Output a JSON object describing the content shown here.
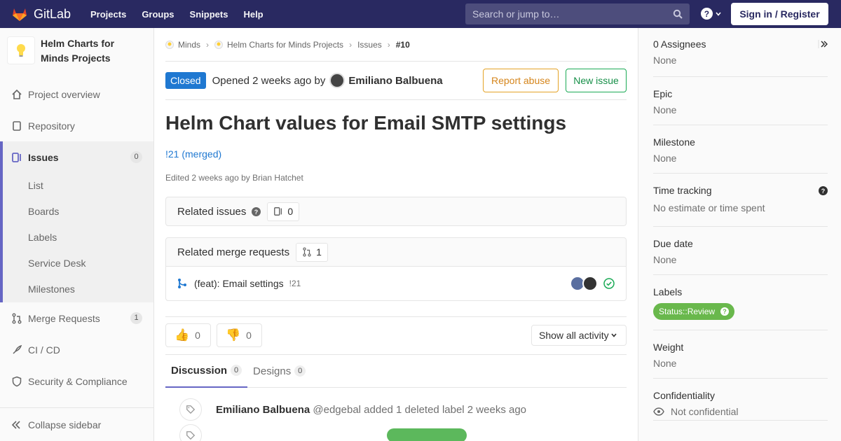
{
  "navbar": {
    "brand": "GitLab",
    "links": [
      "Projects",
      "Groups",
      "Snippets",
      "Help"
    ],
    "search_placeholder": "Search or jump to…",
    "signin_label": "Sign in / Register"
  },
  "sidebar": {
    "project_title": "Helm Charts for Minds Projects",
    "items": [
      {
        "label": "Project overview",
        "icon": "home-icon"
      },
      {
        "label": "Repository",
        "icon": "doc-icon"
      },
      {
        "label": "Issues",
        "icon": "issues-icon",
        "count": "0"
      },
      {
        "label": "Merge Requests",
        "icon": "merge-icon",
        "count": "1"
      },
      {
        "label": "CI / CD",
        "icon": "rocket-icon"
      },
      {
        "label": "Security & Compliance",
        "icon": "shield-icon"
      }
    ],
    "sub_items": [
      "List",
      "Boards",
      "Labels",
      "Service Desk",
      "Milestones"
    ],
    "collapse_label": "Collapse sidebar"
  },
  "breadcrumb": [
    "Minds",
    "Helm Charts for Minds Projects",
    "Issues",
    "#10"
  ],
  "issue": {
    "status": "Closed",
    "opened_text": "Opened 2 weeks ago by",
    "author": "Emiliano Balbuena",
    "report_label": "Report abuse",
    "new_issue_label": "New issue",
    "title": "Helm Chart values for Email SMTP settings",
    "mr_link": "!21 (merged)",
    "edited": "Edited 2 weeks ago by Brian Hatchet"
  },
  "related_issues": {
    "title": "Related issues",
    "count": "0"
  },
  "related_mrs": {
    "title": "Related merge requests",
    "count": "1",
    "items": [
      {
        "title": "(feat): Email settings",
        "ref": "!21"
      }
    ]
  },
  "awards": {
    "thumbs_up": "0",
    "thumbs_down": "0",
    "activity_label": "Show all activity"
  },
  "tabs": [
    {
      "label": "Discussion",
      "count": "0"
    },
    {
      "label": "Designs",
      "count": "0"
    }
  ],
  "notes": [
    {
      "author": "Emiliano Balbuena",
      "handle": "@edgebal",
      "text": "added 1 deleted label 2 weeks ago"
    }
  ],
  "right_sidebar": {
    "assignees_title": "0 Assignees",
    "assignees_value": "None",
    "epic_title": "Epic",
    "epic_value": "None",
    "milestone_title": "Milestone",
    "milestone_value": "None",
    "time_title": "Time tracking",
    "time_value": "No estimate or time spent",
    "due_title": "Due date",
    "due_value": "None",
    "labels_title": "Labels",
    "label_name": "Status::Review",
    "weight_title": "Weight",
    "weight_value": "None",
    "conf_title": "Confidentiality",
    "conf_value": "Not confidential"
  },
  "colors": {
    "navbar": "#292961",
    "closed": "#1f78d1",
    "label": "#69b84c",
    "accent": "#6666c4"
  }
}
